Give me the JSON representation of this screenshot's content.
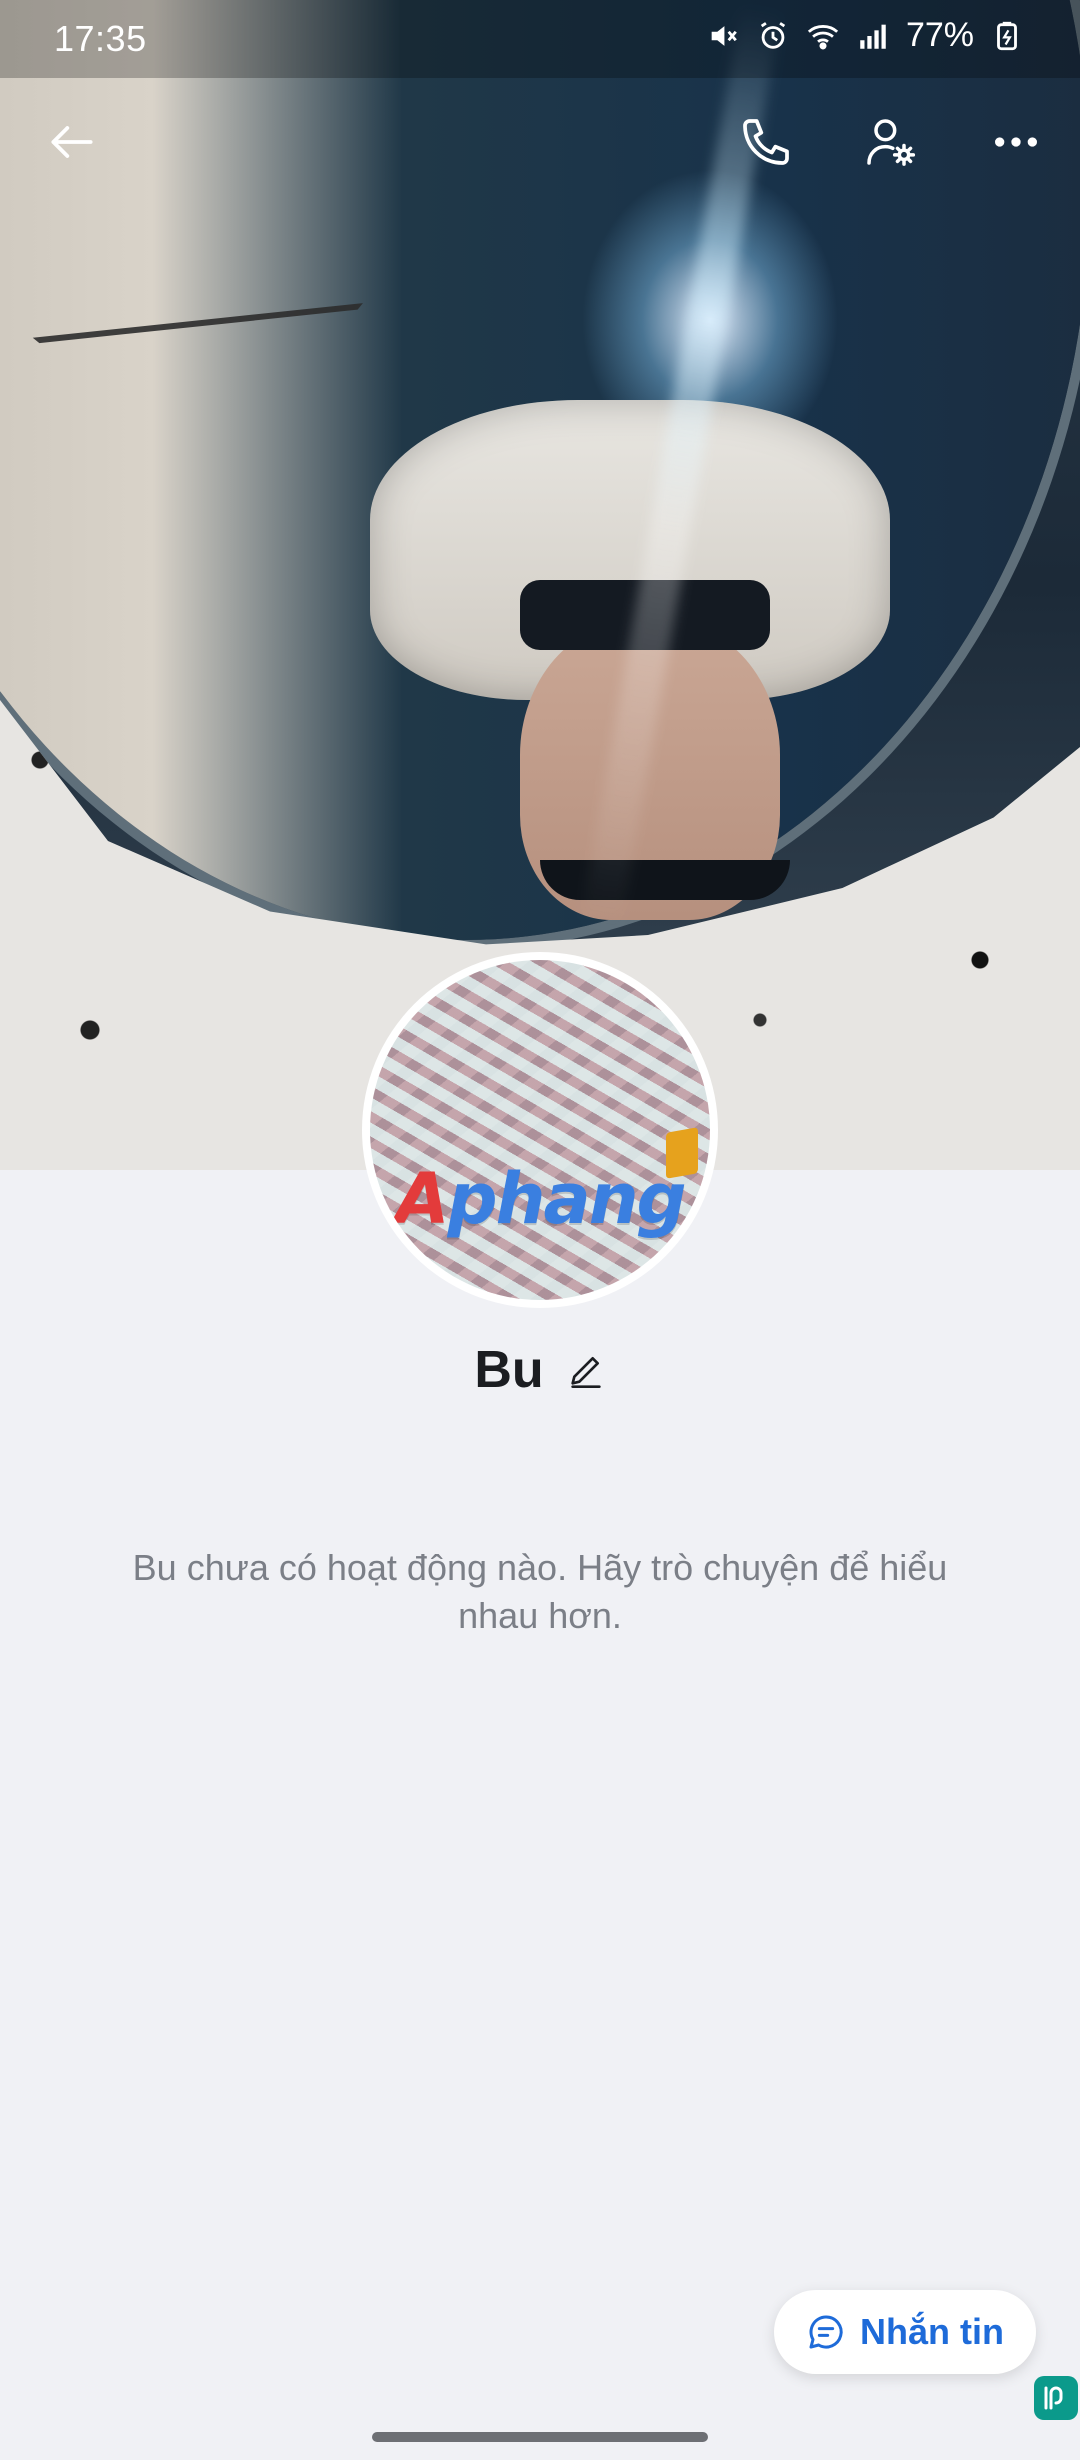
{
  "status_bar": {
    "time": "17:35",
    "battery_percent": "77%",
    "icons": [
      "mute-icon",
      "alarm-icon",
      "wifi-icon",
      "signal-icon",
      "battery-icon"
    ]
  },
  "top_bar": {
    "icons": [
      "back-arrow-icon",
      "phone-icon",
      "user-settings-icon",
      "more-icon"
    ]
  },
  "profile": {
    "name": "Bu",
    "avatar_watermark_first": "A",
    "avatar_watermark_rest": "phang",
    "empty_activity_text": "Bu chưa có hoạt động nào. Hãy trò chuyện để hiểu nhau hơn."
  },
  "actions": {
    "message_label": "Nhắn tin"
  },
  "colors": {
    "accent": "#1e6bd9",
    "background": "#f0f1f5",
    "name_text": "#1b1d21",
    "secondary_text": "#7b7f87"
  }
}
